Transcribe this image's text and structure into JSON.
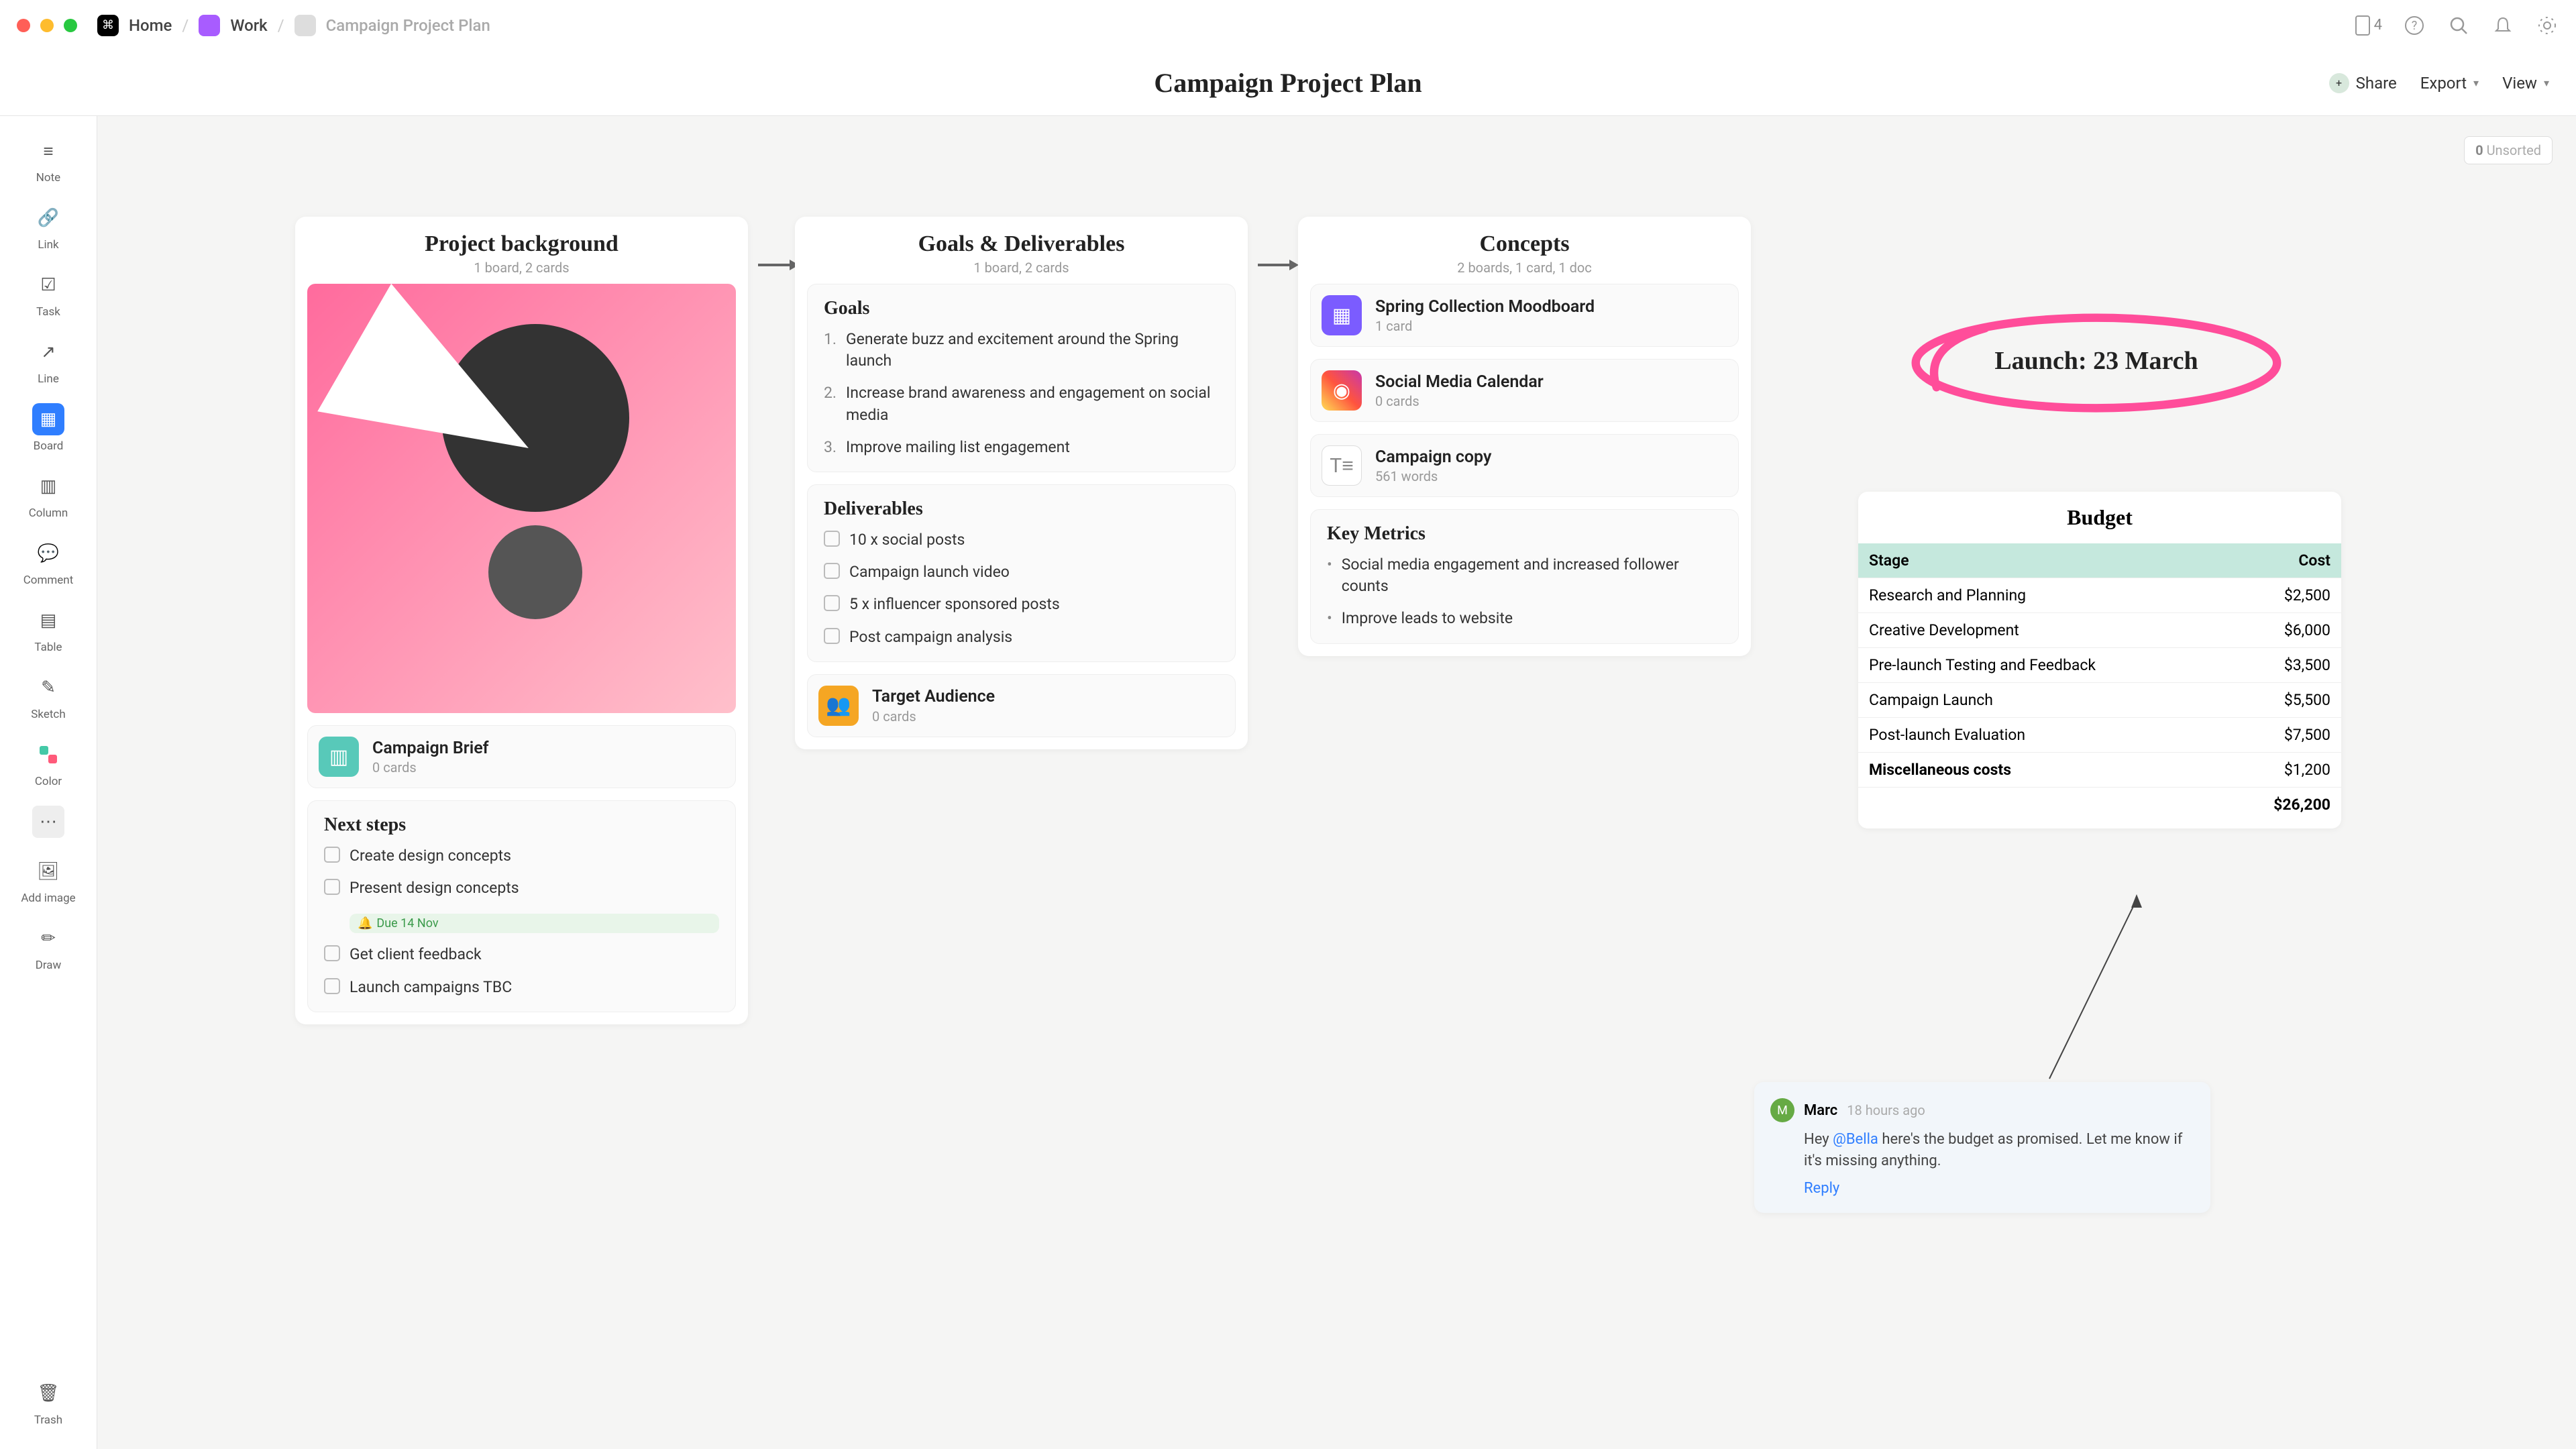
{
  "breadcrumbs": {
    "home": "Home",
    "work": "Work",
    "doc": "Campaign Project Plan"
  },
  "notifCount": "4",
  "pageTitle": "Campaign Project Plan",
  "actions": {
    "share": "Share",
    "export": "Export",
    "view": "View"
  },
  "unsorted": {
    "count": "0",
    "label": "Unsorted"
  },
  "tools": {
    "note": "Note",
    "link": "Link",
    "task": "Task",
    "line": "Line",
    "board": "Board",
    "column": "Column",
    "comment": "Comment",
    "table": "Table",
    "sketch": "Sketch",
    "color": "Color",
    "addimage": "Add image",
    "draw": "Draw",
    "trash": "Trash",
    "more": ""
  },
  "board1": {
    "title": "Project background",
    "sub": "1 board, 2 cards",
    "brief": {
      "title": "Campaign Brief",
      "sub": "0 cards"
    },
    "next": {
      "title": "Next steps",
      "items": [
        "Create design concepts",
        "Present design concepts",
        "Get client feedback",
        "Launch campaigns TBC"
      ],
      "due": "Due 14 Nov"
    }
  },
  "board2": {
    "title": "Goals & Deliverables",
    "sub": "1 board, 2 cards",
    "goals": {
      "title": "Goals",
      "items": [
        "Generate buzz and excitement around the Spring launch",
        "Increase brand awareness and engagement on social media",
        "Improve mailing list engagement"
      ]
    },
    "deliv": {
      "title": "Deliverables",
      "items": [
        "10 x social posts",
        "Campaign launch video",
        "5 x influencer sponsored posts",
        "Post campaign analysis"
      ]
    },
    "audience": {
      "title": "Target Audience",
      "sub": "0 cards"
    }
  },
  "board3": {
    "title": "Concepts",
    "sub": "2 boards, 1 card, 1 doc",
    "mood": {
      "title": "Spring Collection Moodboard",
      "sub": "1 card"
    },
    "social": {
      "title": "Social Media Calendar",
      "sub": "0 cards"
    },
    "copy": {
      "title": "Campaign copy",
      "sub": "561 words"
    },
    "metrics": {
      "title": "Key Metrics",
      "items": [
        "Social media engagement and increased follower counts",
        "Improve leads to website"
      ]
    }
  },
  "launch": "Launch: 23 March",
  "budget": {
    "title": "Budget",
    "headers": [
      "Stage",
      "Cost"
    ],
    "rows": [
      [
        "Research and Planning",
        "$2,500"
      ],
      [
        "Creative Development",
        "$6,000"
      ],
      [
        "Pre-launch Testing and Feedback",
        "$3,500"
      ],
      [
        "Campaign Launch",
        "$5,500"
      ],
      [
        "Post-launch Evaluation",
        "$7,500"
      ],
      [
        "Miscellaneous costs",
        "$1,200"
      ]
    ],
    "total": "$26,200"
  },
  "comment": {
    "author": "Marc",
    "time": "18 hours ago",
    "pre": "Hey ",
    "mention": "@Bella",
    "post": " here's the budget as promised. Let me know if it's missing anything.",
    "reply": "Reply"
  }
}
